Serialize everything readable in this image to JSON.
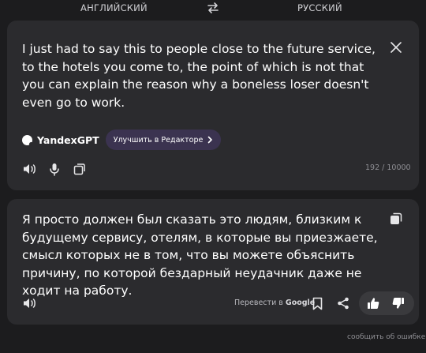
{
  "languages": {
    "source": "АНГЛИЙСКИЙ",
    "target": "РУССКИЙ"
  },
  "source_card": {
    "text": "I just had to say this to people close to the future service, to the hotels you come to, the point of which is not that you can explain the reason why a boneless loser doesn't even go to work.",
    "gpt_label": "YandexGPT",
    "improve_label": "Улучшить в Редакторе",
    "char_counter": "192 / 10000"
  },
  "target_card": {
    "text": "Я просто должен был сказать это людям, близким к будущему сервису, отелям, в которые вы приезжаете, смысл которых не в том, что вы можете объяснить причину, по которой бездарный неудачник даже не ходит на работу.",
    "google_prefix": "Перевести в ",
    "google_name": "Google"
  },
  "footer": {
    "report_label": "сообщить об ошибке"
  },
  "icons": {
    "swap": "swap-icon",
    "close": "close-icon",
    "speaker": "speaker-icon",
    "mic": "microphone-icon",
    "copy": "copy-icon",
    "bookmark": "bookmark-icon",
    "share": "share-icon",
    "like": "thumbs-up-icon",
    "dislike": "thumbs-down-icon"
  },
  "colors": {
    "background": "#1c1c1e",
    "card": "#2b2b2e",
    "improve_button": "#3b3350",
    "muted_text": "#8e8e93"
  }
}
